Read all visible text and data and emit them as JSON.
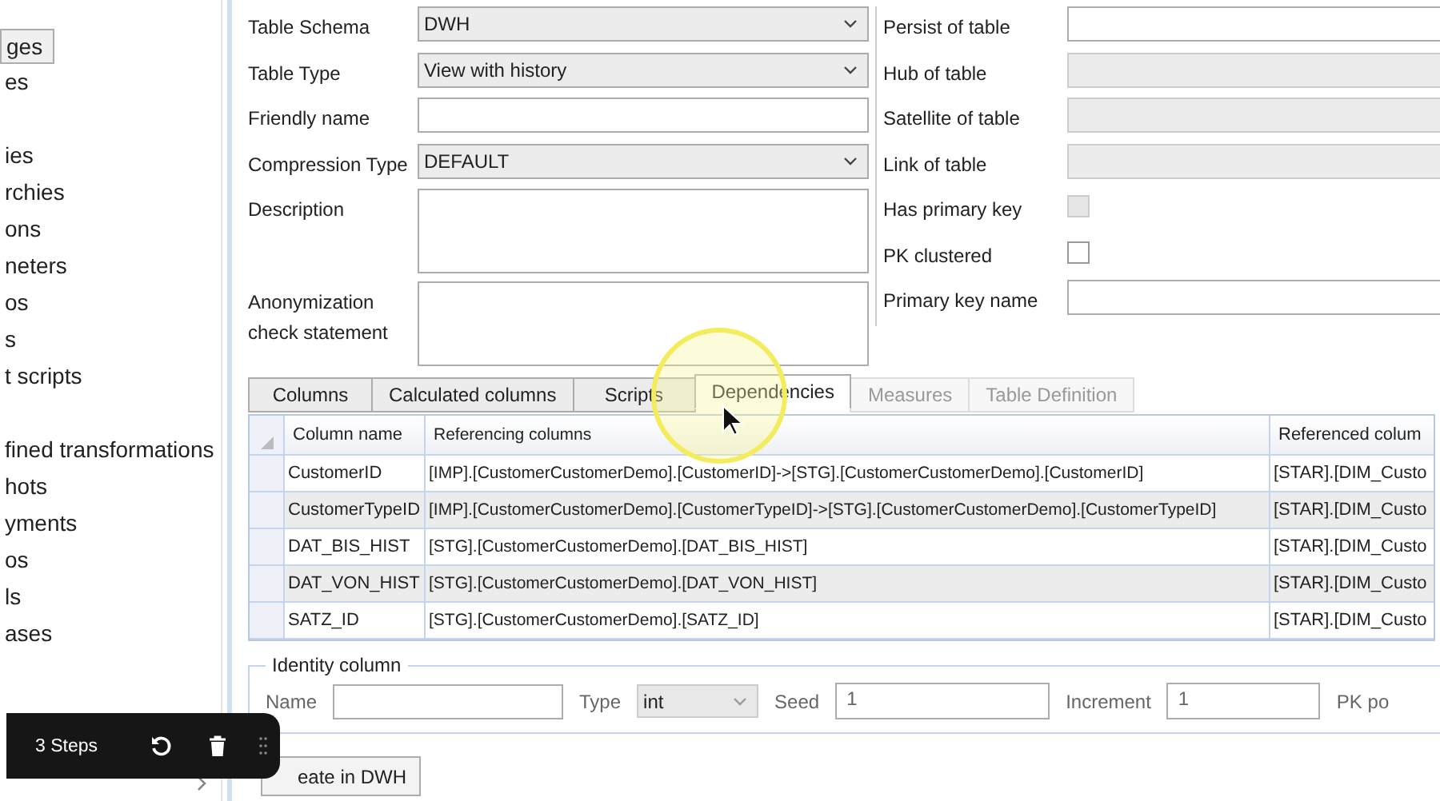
{
  "sidebar": {
    "groups": [
      [
        {
          "label": "ges",
          "selected": true
        },
        {
          "label": "es",
          "selected": false
        }
      ],
      [
        {
          "label": "ies",
          "selected": false
        },
        {
          "label": "rchies",
          "selected": false
        },
        {
          "label": "ons",
          "selected": false
        },
        {
          "label": "neters",
          "selected": false
        },
        {
          "label": "os",
          "selected": false
        },
        {
          "label": "s",
          "selected": false
        },
        {
          "label": "t scripts",
          "selected": false
        }
      ],
      [
        {
          "label": "fined transformations",
          "selected": false
        },
        {
          "label": "hots",
          "selected": false
        },
        {
          "label": "yments",
          "selected": false
        },
        {
          "label": "os",
          "selected": false
        },
        {
          "label": "ls",
          "selected": false
        },
        {
          "label": "ases",
          "selected": false
        }
      ]
    ]
  },
  "form": {
    "left": [
      {
        "kind": "select",
        "label": "Table Schema",
        "value": "DWH"
      },
      {
        "kind": "select",
        "label": "Table Type",
        "value": "View with history"
      },
      {
        "kind": "input",
        "label": "Friendly name"
      },
      {
        "kind": "select",
        "label": "Compression Type",
        "value": "DEFAULT"
      },
      {
        "kind": "textarea",
        "label": "Description"
      },
      {
        "kind": "textarea",
        "label": "Anonymization check statement"
      }
    ],
    "right": [
      {
        "kind": "input",
        "label": "Persist of table",
        "disabled": false
      },
      {
        "kind": "input",
        "label": "Hub of table",
        "disabled": true
      },
      {
        "kind": "input",
        "label": "Satellite of table",
        "disabled": true
      },
      {
        "kind": "input",
        "label": "Link of table",
        "disabled": true
      },
      {
        "kind": "checkbox",
        "label": "Has primary key",
        "disabled": true,
        "checked": false
      },
      {
        "kind": "checkbox",
        "label": "PK clustered",
        "disabled": false,
        "checked": false
      },
      {
        "kind": "input",
        "label": "Primary key name",
        "disabled": false
      }
    ]
  },
  "tabs": [
    {
      "label": "Columns",
      "selected": false,
      "disabled": false
    },
    {
      "label": "Calculated columns",
      "selected": false,
      "disabled": false
    },
    {
      "label": "Scripts",
      "selected": false,
      "disabled": false
    },
    {
      "label": "Dependencies",
      "selected": true,
      "disabled": false
    },
    {
      "label": "Measures",
      "selected": false,
      "disabled": true
    },
    {
      "label": "Table Definition",
      "selected": false,
      "disabled": true
    }
  ],
  "table": {
    "columns": [
      "Column name",
      "Referencing columns",
      "Referenced colum"
    ],
    "rows": [
      [
        "CustomerID",
        "[IMP].[CustomerCustomerDemo].[CustomerID]->[STG].[CustomerCustomerDemo].[CustomerID]",
        "[STAR].[DIM_Custo"
      ],
      [
        "CustomerTypeID",
        "[IMP].[CustomerCustomerDemo].[CustomerTypeID]->[STG].[CustomerCustomerDemo].[CustomerTypeID]",
        "[STAR].[DIM_Custo"
      ],
      [
        "DAT_BIS_HIST",
        "[STG].[CustomerCustomerDemo].[DAT_BIS_HIST]",
        "[STAR].[DIM_Custo"
      ],
      [
        "DAT_VON_HIST",
        "[STG].[CustomerCustomerDemo].[DAT_VON_HIST]",
        "[STAR].[DIM_Custo"
      ],
      [
        "SATZ_ID",
        "[STG].[CustomerCustomerDemo].[SATZ_ID]",
        "[STAR].[DIM_Custo"
      ]
    ]
  },
  "identity": {
    "title": "Identity column",
    "name_label": "Name",
    "type_label": "Type",
    "type_value": "int",
    "seed_label": "Seed",
    "seed_value": "1",
    "increment_label": "Increment",
    "increment_value": "1",
    "pk_label": "PK po"
  },
  "create_button": "eate in DWH",
  "recorder": {
    "steps": "3 Steps"
  }
}
